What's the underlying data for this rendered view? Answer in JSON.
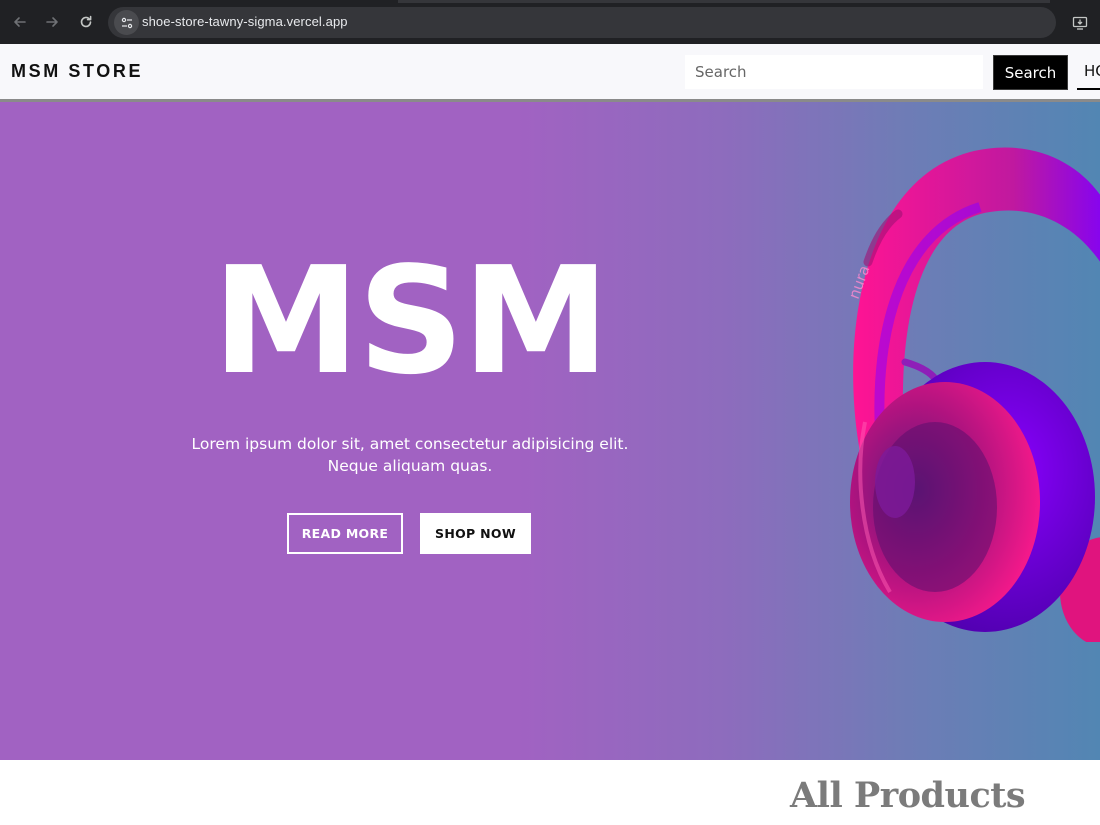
{
  "browser": {
    "url": "shoe-store-tawny-sigma.vercel.app",
    "icons": [
      "back-arrow-icon",
      "forward-arrow-icon",
      "reload-icon",
      "site-info-icon",
      "install-app-icon"
    ]
  },
  "header": {
    "logo": "MSM STORE",
    "search_placeholder": "Search",
    "search_button": "Search",
    "nav_home": "HOME"
  },
  "hero": {
    "title": "MSM",
    "text": "Lorem ipsum dolor sit, amet consectetur adipisicing elit. Neque aliquam quas.",
    "read_more": "READ MORE",
    "shop_now": "SHOP NOW",
    "brand_on_product": "nura",
    "gradient_start": "#a162c2",
    "gradient_end": "#5286b3"
  },
  "products": {
    "title": "All Products"
  }
}
